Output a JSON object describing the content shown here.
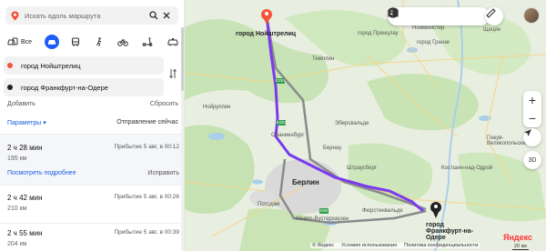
{
  "search": {
    "placeholder": "Искать вдоль маршрута"
  },
  "modes": {
    "all_label": "Все",
    "active": "car"
  },
  "points": {
    "from": "город Нойштрелиц",
    "to": "город Франкфурт-на-Одере"
  },
  "links": {
    "add": "Добавить",
    "reset": "Сбросить"
  },
  "params": {
    "label": "Параметры ▾",
    "departure": "Отправление сейчас"
  },
  "routes": [
    {
      "time": "2 ч 28 мин",
      "arrival": "Прибытие 5 авг, в 00:12",
      "distance": "195 км",
      "details": "Посмотреть подробнее",
      "fix": "Исправить"
    },
    {
      "time": "2 ч 42 мин",
      "arrival": "Прибытие 5 авг, в 00:26",
      "distance": "210 км"
    },
    {
      "time": "2 ч 55 мин",
      "arrival": "Прибытие 5 авг, в 00:39",
      "distance": "204 км"
    }
  ],
  "map": {
    "start_label": "город Нойштрелиц",
    "end_label": "город Франкфурт-на-Одере",
    "city_berlin": "Берлин",
    "labels": [
      "город Пренцлау",
      "Темплин",
      "город Гранзе",
      "Нойруппин",
      "Эберсвальде",
      "Ораниенбург",
      "Бернау",
      "Штраусберг",
      "Потсдам",
      "Фюрстенвальде",
      "Кёнигс-Вустерхаузен",
      "Костшин-над-Одрой",
      "Гожув-Великопольский",
      "Щецин",
      "Ноймюнстер"
    ],
    "road_badges": [
      "E251",
      "E251",
      "E55"
    ],
    "zoom_in": "+",
    "zoom_out": "−",
    "three_d": "3D",
    "footer": [
      "© Яндекс",
      "Условия использования",
      "Политика конфиденциальности"
    ],
    "logo": "Яндекс",
    "scale": "20 км"
  },
  "colors": {
    "accent": "#1e5ef7",
    "route_main": "#7c3aed",
    "route_alt": "#888888",
    "start_pin": "#f2543a",
    "end_pin": "#222222"
  }
}
